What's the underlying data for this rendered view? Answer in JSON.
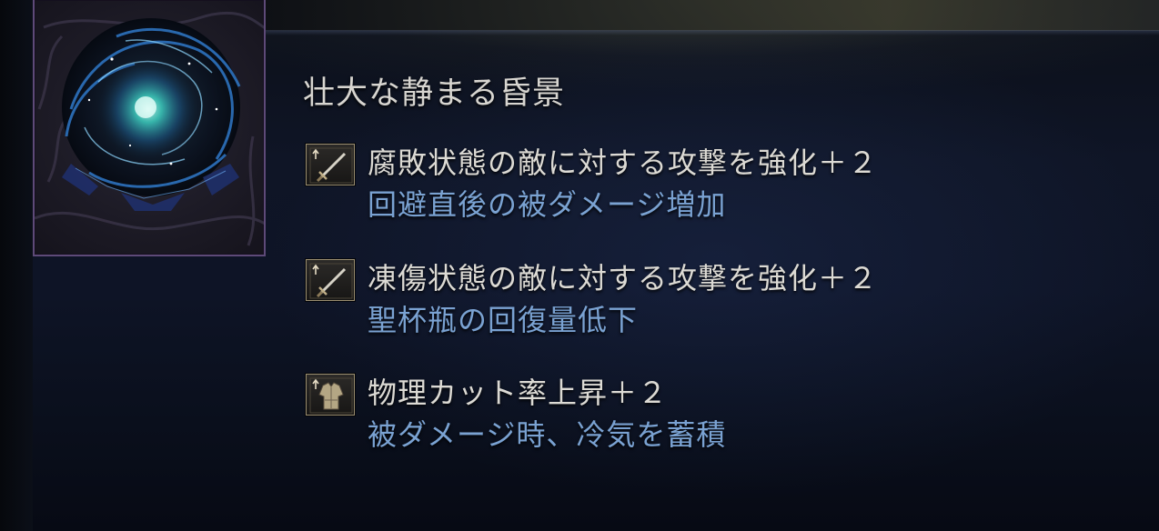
{
  "relic": {
    "name": "壮大な静まる昏景",
    "image_icon": "dark-night-relic-icon"
  },
  "effects": [
    {
      "icon": "weapon-sword-icon",
      "text": "腐敗状態の敵に対する攻撃を強化＋２",
      "penalty": "回避直後の被ダメージ増加"
    },
    {
      "icon": "weapon-sword-icon",
      "text": "凍傷状態の敵に対する攻撃を強化＋２",
      "penalty": "聖杯瓶の回復量低下"
    },
    {
      "icon": "armor-chest-icon",
      "text": "物理カット率上昇＋２",
      "penalty": "被ダメージ時、冷気を蓄積"
    }
  ],
  "colors": {
    "effect_text": "#dcdad4",
    "penalty_text": "#7aa2d2",
    "frame_border": "#5e4a78"
  }
}
